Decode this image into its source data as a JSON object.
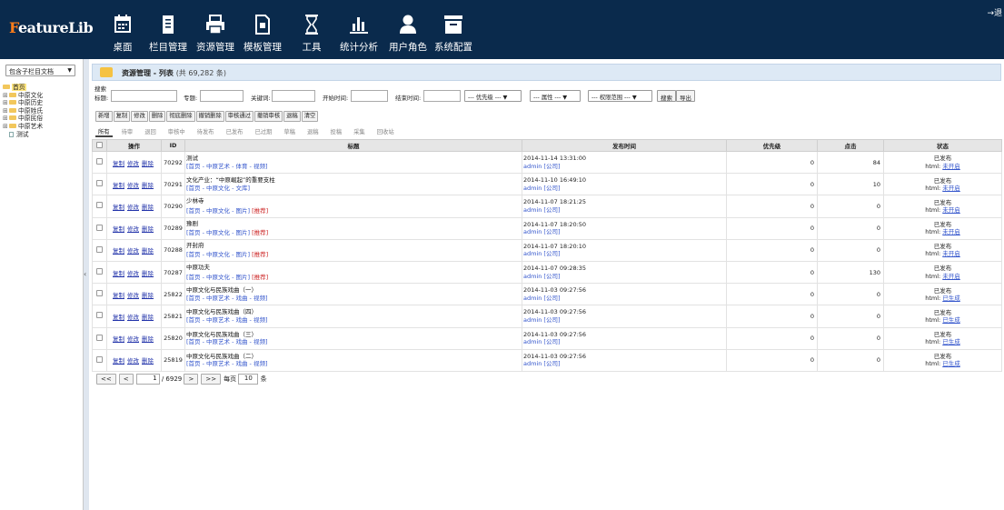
{
  "app": {
    "logo_first": "F",
    "logo_rest": "eatureLib",
    "logout": "退"
  },
  "nav": [
    {
      "label": "桌面",
      "icon": "desktop-icon"
    },
    {
      "label": "栏目管理",
      "icon": "column-doc-icon"
    },
    {
      "label": "资源管理",
      "icon": "printer-icon"
    },
    {
      "label": "模板管理",
      "icon": "template-icon"
    },
    {
      "label": "工具",
      "icon": "hourglass-icon"
    },
    {
      "label": "统计分析",
      "icon": "bar-chart-icon"
    },
    {
      "label": "用户角色",
      "icon": "user-icon"
    },
    {
      "label": "系统配置",
      "icon": "server-icon"
    }
  ],
  "sidebar": {
    "select_value": "包含子栏目文档",
    "tree": [
      {
        "label": "首页",
        "type": "root"
      },
      {
        "label": "中原文化",
        "type": "folder"
      },
      {
        "label": "中原历史",
        "type": "folder"
      },
      {
        "label": "中原姓氏",
        "type": "folder"
      },
      {
        "label": "中原民俗",
        "type": "folder"
      },
      {
        "label": "中原艺术",
        "type": "folder"
      },
      {
        "label": "测试",
        "type": "doc"
      }
    ]
  },
  "main": {
    "title": "资源管理 - 列表",
    "count": "(共 69,282 条)",
    "search": {
      "label": "搜索",
      "title_label": "标题:",
      "topic_label": "专题:",
      "keyword_label": "关键词:",
      "start_label": "开始时间:",
      "end_label": "结束时间:",
      "priority": "--- 优先级 ---",
      "attribute": "--- 属性 ---",
      "scope": "--- 权限范围 ---",
      "search_btn": "搜索",
      "export_btn": "导出"
    },
    "toolbar": [
      "新增",
      "复制",
      "修改",
      "删除",
      "彻底删除",
      "撤销删除",
      "审核通过",
      "撤销审核",
      "退稿",
      "清空"
    ],
    "tabs": [
      "所有",
      "待审",
      "退回",
      "审核中",
      "待发布",
      "已发布",
      "已过期",
      "草稿",
      "退稿",
      "投稿",
      "采集",
      "回收站"
    ],
    "columns": {
      "op": "操作",
      "id": "ID",
      "title": "标题",
      "time": "发布时间",
      "priority": "优先级",
      "clicks": "点击",
      "status": "状态"
    },
    "op_labels": {
      "copy": "复制",
      "edit": "修改",
      "delete": "删除"
    },
    "rows": [
      {
        "id": "70292",
        "title": "测试",
        "path": "[首页 - 中原艺术 - 体育 - 视频]",
        "tag": "",
        "date": "2014-11-14 13:31:00",
        "author": "admin [公司]",
        "priority": "0",
        "clicks": "84",
        "status": "已发布",
        "html_label": "html:",
        "html": "未开启"
      },
      {
        "id": "70291",
        "title": "文化产业：“中原崛起”的重要支柱",
        "path": "[首页 - 中原文化 - 文库]",
        "tag": "",
        "date": "2014-11-10 16:49:10",
        "author": "admin [公司]",
        "priority": "0",
        "clicks": "10",
        "status": "已发布",
        "html_label": "html:",
        "html": "未开启"
      },
      {
        "id": "70290",
        "title": "少林寺",
        "path": "[首页 - 中原文化 - 图片]",
        "tag": "[推荐]",
        "date": "2014-11-07 18:21:25",
        "author": "admin [公司]",
        "priority": "0",
        "clicks": "0",
        "status": "已发布",
        "html_label": "html:",
        "html": "未开启"
      },
      {
        "id": "70289",
        "title": "豫剧",
        "path": "[首页 - 中原文化 - 图片]",
        "tag": "[推荐]",
        "date": "2014-11-07 18:20:50",
        "author": "admin [公司]",
        "priority": "0",
        "clicks": "0",
        "status": "已发布",
        "html_label": "html:",
        "html": "未开启"
      },
      {
        "id": "70288",
        "title": "开封府",
        "path": "[首页 - 中原文化 - 图片]",
        "tag": "[推荐]",
        "date": "2014-11-07 18:20:10",
        "author": "admin [公司]",
        "priority": "0",
        "clicks": "0",
        "status": "已发布",
        "html_label": "html:",
        "html": "未开启"
      },
      {
        "id": "70287",
        "title": "中原功夫",
        "path": "[首页 - 中原文化 - 图片]",
        "tag": "[推荐]",
        "date": "2014-11-07 09:28:35",
        "author": "admin [公司]",
        "priority": "0",
        "clicks": "130",
        "status": "已发布",
        "html_label": "html:",
        "html": "未开启"
      },
      {
        "id": "25822",
        "title": "中原文化与民族戏曲（一）",
        "path": "[首页 - 中原艺术 - 戏曲 - 视频]",
        "tag": "",
        "date": "2014-11-03 09:27:56",
        "author": "admin [公司]",
        "priority": "0",
        "clicks": "0",
        "status": "已发布",
        "html_label": "html:",
        "html": "已生成"
      },
      {
        "id": "25821",
        "title": "中原文化与民族戏曲（四）",
        "path": "[首页 - 中原艺术 - 戏曲 - 视频]",
        "tag": "",
        "date": "2014-11-03 09:27:56",
        "author": "admin [公司]",
        "priority": "0",
        "clicks": "0",
        "status": "已发布",
        "html_label": "html:",
        "html": "已生成"
      },
      {
        "id": "25820",
        "title": "中原文化与民族戏曲（三）",
        "path": "[首页 - 中原艺术 - 戏曲 - 视频]",
        "tag": "",
        "date": "2014-11-03 09:27:56",
        "author": "admin [公司]",
        "priority": "0",
        "clicks": "0",
        "status": "已发布",
        "html_label": "html:",
        "html": "已生成"
      },
      {
        "id": "25819",
        "title": "中原文化与民族戏曲（二）",
        "path": "[首页 - 中原艺术 - 戏曲 - 视频]",
        "tag": "",
        "date": "2014-11-03 09:27:56",
        "author": "admin [公司]",
        "priority": "0",
        "clicks": "0",
        "status": "已发布",
        "html_label": "html:",
        "html": "已生成"
      }
    ],
    "pager": {
      "first": "<<",
      "prev": "<",
      "page": "1",
      "total": "/ 6929",
      "next": ">",
      "last": ">>",
      "per_label": "每页",
      "per": "10",
      "unit": "条"
    }
  },
  "colors": {
    "topbar": "#0a2a4c",
    "logo_accent": "#ff7d1a",
    "link": "#3355cc",
    "tag_red": "#cc2222"
  }
}
